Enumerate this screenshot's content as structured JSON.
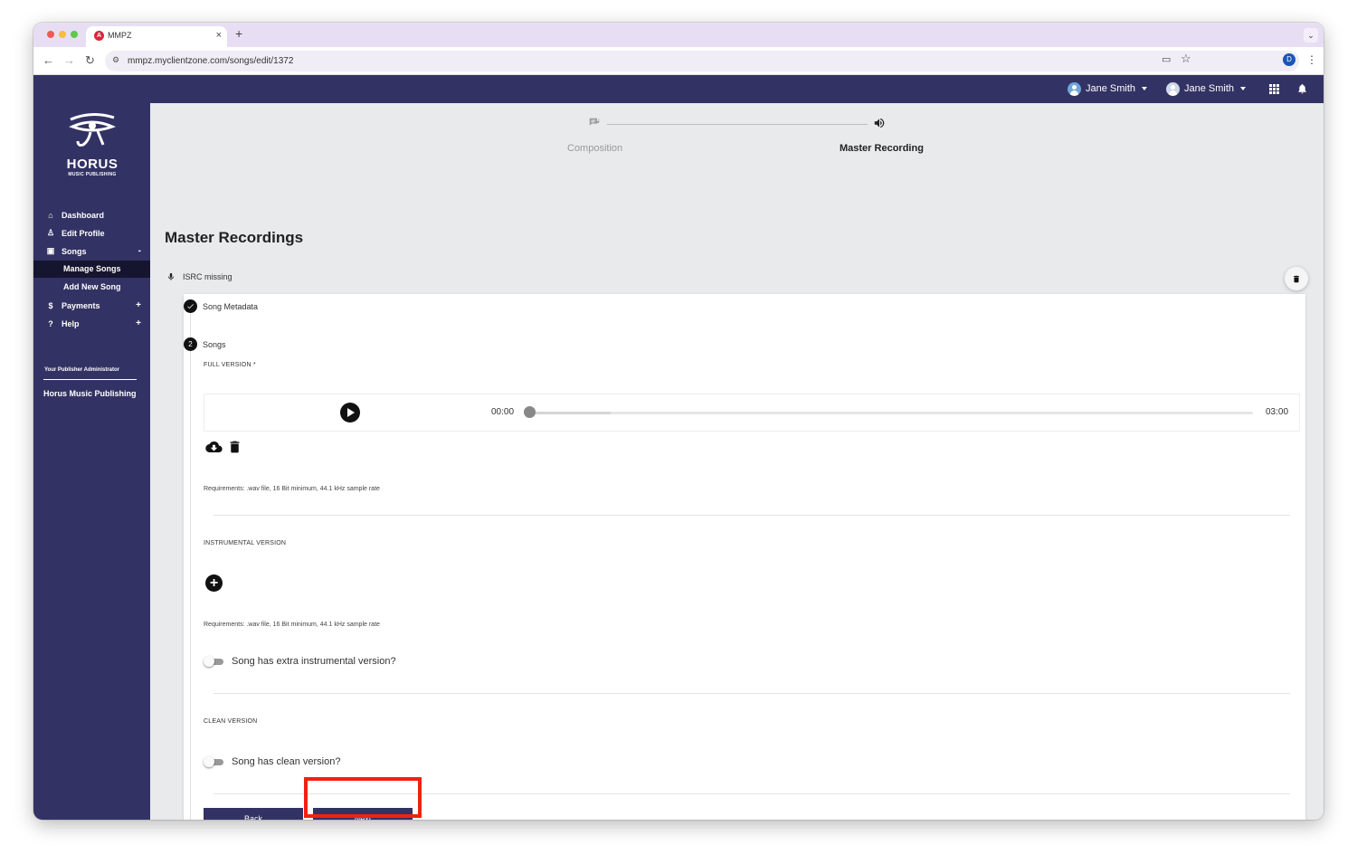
{
  "browser": {
    "tab_title": "MMPZ",
    "tab_close": "×",
    "new_tab": "+",
    "url": "mmpz.myclientzone.com/songs/edit/1372",
    "profile_initial": "D"
  },
  "header": {
    "users": [
      {
        "name": "Jane Smith",
        "avatar": "person-avatar-blue"
      },
      {
        "name": "Jane Smith",
        "avatar": "person-avatar-grey"
      }
    ],
    "icons": [
      "apps-grid-icon",
      "bell-icon"
    ]
  },
  "sidebar": {
    "logo_text": "HORUS",
    "logo_sub": "MUSIC PUBLISHING",
    "items": [
      {
        "label": "Dashboard",
        "icon": "home-icon"
      },
      {
        "label": "Edit Profile",
        "icon": "profile-icon"
      },
      {
        "label": "Songs",
        "icon": "songs-icon",
        "toggle": "-"
      },
      {
        "label": "Manage Songs"
      },
      {
        "label": "Add New Song"
      },
      {
        "label": "Payments",
        "icon": "dollar-icon",
        "toggle": "+"
      },
      {
        "label": "Help",
        "icon": "help-icon",
        "toggle": "+"
      }
    ],
    "publisher_label": "Your Publisher Administrator",
    "publisher_name": "Horus Music Publishing"
  },
  "stepper": {
    "steps": [
      {
        "label": "Composition",
        "icon": "lyrics-icon",
        "active": false
      },
      {
        "label": "Master Recording",
        "icon": "volume-icon",
        "active": true
      }
    ]
  },
  "page": {
    "title": "Master Recordings",
    "isrc_status": "ISRC missing"
  },
  "form": {
    "step1_label": "Song Metadata",
    "step2_number": "2",
    "step2_label": "Songs",
    "full_version_label": "FULL VERSION *",
    "player": {
      "current": "00:00",
      "total": "03:00",
      "progress": 0
    },
    "requirements": "Requirements: .wav file, 16 Bit minimum, 44.1 kHz sample rate",
    "instrumental_label": "INSTRUMENTAL VERSION",
    "extra_instrumental_toggle": "Song has extra instrumental version?",
    "clean_label": "CLEAN VERSION",
    "clean_toggle": "Song has clean version?",
    "back_label": "Back",
    "next_label": "Next"
  },
  "colors": {
    "brand": "#333264",
    "highlight": "#f0220f",
    "background": "#e9eaec"
  }
}
